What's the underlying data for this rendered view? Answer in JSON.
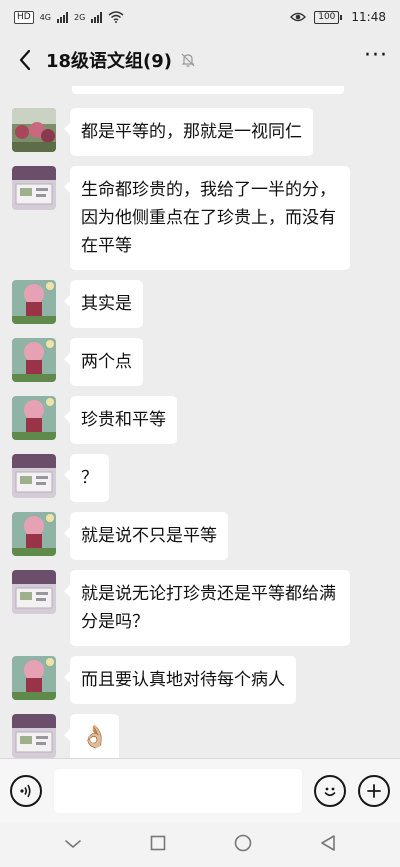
{
  "status_bar": {
    "left_chip": "HD",
    "net1": "4G",
    "net2": "2G",
    "battery": "100",
    "time": "11:48"
  },
  "header": {
    "title": "18级语文组(9)",
    "more": "···"
  },
  "messages": [
    {
      "avatar": "avatar-a",
      "text": "都是平等的，那就是一视同仁"
    },
    {
      "avatar": "avatar-b",
      "text": "生命都珍贵的，我给了一半的分，因为他侧重点在了珍贵上，而没有在平等"
    },
    {
      "avatar": "avatar-c",
      "text": "其实是"
    },
    {
      "avatar": "avatar-c",
      "text": "两个点"
    },
    {
      "avatar": "avatar-c",
      "text": "珍贵和平等"
    },
    {
      "avatar": "avatar-b",
      "text": "？"
    },
    {
      "avatar": "avatar-c",
      "text": "就是说不只是平等"
    },
    {
      "avatar": "avatar-b",
      "text": "就是说无论打珍贵还是平等都给满分是吗？"
    },
    {
      "avatar": "avatar-c",
      "text": "而且要认真地对待每个病人"
    },
    {
      "avatar": "avatar-b",
      "text": "👌🏼"
    }
  ],
  "input": {
    "placeholder": ""
  }
}
